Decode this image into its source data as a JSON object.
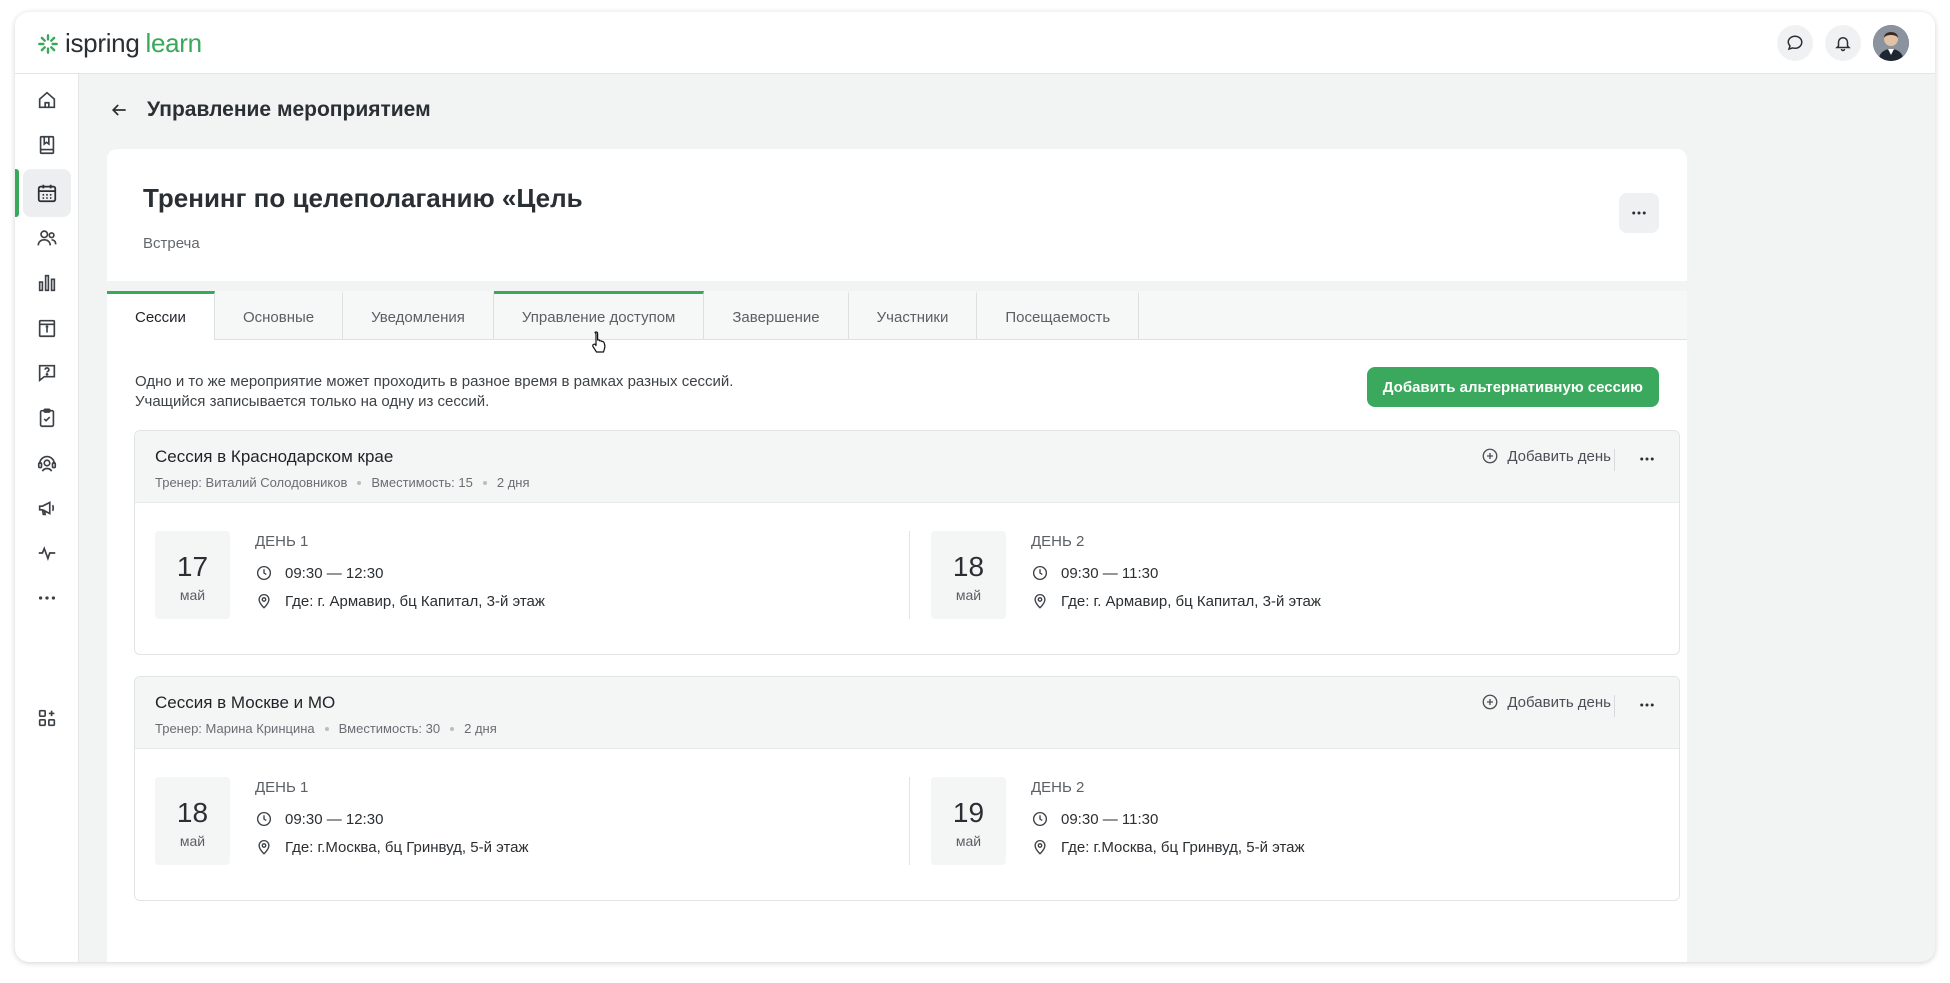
{
  "app": {
    "logo_part1": "ispring",
    "logo_part2": "learn",
    "brand_color": "#39a85b"
  },
  "topbar": {
    "icons": [
      "chat-icon",
      "bell-icon",
      "avatar"
    ]
  },
  "sidebar": {
    "items": [
      "home-icon",
      "book-icon",
      "calendar-icon",
      "users-icon",
      "bar-chart-icon",
      "info-board-icon",
      "help-chat-icon",
      "clipboard-check-icon",
      "support-agent-icon",
      "megaphone-icon",
      "activity-icon",
      "more-icon",
      "add-widgets-icon"
    ],
    "active_index": 2
  },
  "page": {
    "title": "Управление мероприятием"
  },
  "event": {
    "title": "Тренинг по целеполаганию «Цель",
    "type": "Встреча"
  },
  "tabs": [
    {
      "label": "Сессии",
      "active": true
    },
    {
      "label": "Основные",
      "active": false
    },
    {
      "label": "Уведомления",
      "active": false
    },
    {
      "label": "Управление доступом",
      "active": false
    },
    {
      "label": "Завершение",
      "active": false
    },
    {
      "label": "Участники",
      "active": false
    },
    {
      "label": "Посещаемость",
      "active": false
    }
  ],
  "intro": {
    "line1": "Одно и то же мероприятие может проходить в разное время в рамках разных сессий.",
    "line2": "Учащийся записывается только на одну из сессий.",
    "add_alt_session": "Добавить альтернативную сессию"
  },
  "sessions": [
    {
      "name": "Сессия в Краснодарском крае",
      "trainer": "Тренер: Виталий Солодовников",
      "capacity": "Вместимость: 15",
      "duration": "2 дня",
      "add_day": "Добавить день",
      "days": [
        {
          "num": "17",
          "month": "май",
          "title": "ДЕНЬ 1",
          "time": "09:30 — 12:30",
          "place": "Где: г. Армавир, бц Капитал, 3-й этаж"
        },
        {
          "num": "18",
          "month": "май",
          "title": "ДЕНЬ 2",
          "time": "09:30 — 11:30",
          "place": "Где: г. Армавир, бц Капитал, 3-й этаж"
        }
      ]
    },
    {
      "name": "Сессия в Москве и МО",
      "trainer": "Тренер: Марина Кринцина",
      "capacity": "Вместимость: 30",
      "duration": "2 дня",
      "add_day": "Добавить день",
      "days": [
        {
          "num": "18",
          "month": "май",
          "title": "ДЕНЬ 1",
          "time": "09:30 — 12:30",
          "place": "Где: г.Москва, бц Гринвуд, 5-й этаж"
        },
        {
          "num": "19",
          "month": "май",
          "title": "ДЕНЬ 2",
          "time": "09:30 — 11:30",
          "place": "Где: г.Москва, бц Гринвуд, 5-й этаж"
        }
      ]
    }
  ]
}
